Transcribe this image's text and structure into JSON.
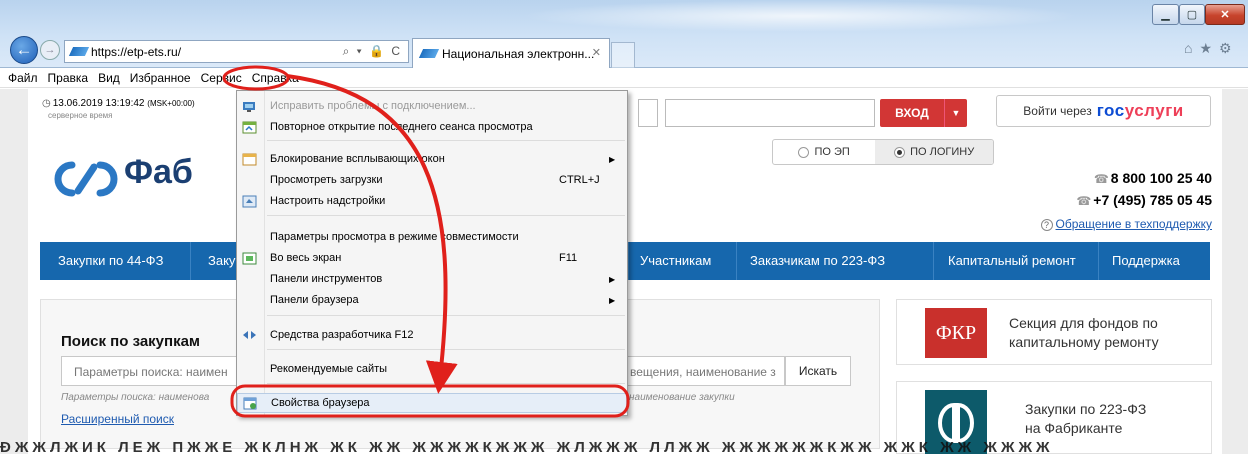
{
  "browser": {
    "url": "https://etp-ets.ru/",
    "tab_title": "Национальная электронн...",
    "tab_close": "✕",
    "min_glyph": "▁",
    "max_glyph": "▢",
    "close_glyph": "✕",
    "back_glyph": "←",
    "fwd_glyph": "→",
    "addr_tools": "⌕ ▾ 🔒 C",
    "right_icons": "⌂★⚙"
  },
  "menubar": [
    "Файл",
    "Правка",
    "Вид",
    "Избранное",
    "Сервис",
    "Справка"
  ],
  "page": {
    "server_time": "13.06.2019 13:19:42",
    "server_tz": "(MSK+00:00)",
    "server_sub": "серверное время",
    "login_btn": "ВХОД",
    "gos_prefix": "Войти через",
    "gos_a": "гос",
    "gos_b": "услуги",
    "seg_ep": "ПО ЭП",
    "seg_login": "ПО ЛОГИНУ",
    "logo_text": "Фаб",
    "phone1": "8 800 100 25 40",
    "phone2": "+7 (495) 785 05 45",
    "support": "Обращение в техподдержку",
    "nav": [
      "Закупки по 44-ФЗ",
      "Заку",
      "Участникам",
      "Заказчикам по 223-ФЗ",
      "Капитальный ремонт",
      "Поддержка"
    ],
    "search_title": "Поиск по закупкам",
    "search_left": "Параметры поиска: наимен",
    "search_right": "вещения, наименование з",
    "search_btn": "Искать",
    "hint_left": "Параметры поиска: наименова",
    "hint_right": "наименование закупки",
    "adv_link": "Расширенный поиск",
    "card1_icon": "ФКР",
    "card1_text": [
      "Секция для фондов по",
      "капитальному ремонту"
    ],
    "card2_text": [
      "Закупки по 223-ФЗ",
      "на Фабриканте"
    ],
    "garble": "ÐЖЖЛЖИК ЛЕЖ ПЖЖЕ ЖКЛНЖ ЖК ЖЖ ЖЖЖЖКЖЖЖ ЖЛЖЖЖ ЛЛЖЖ ЖЖЖЖЖЖКЖЖ ЖЖК ЖЖ ЖЖЖЖ"
  },
  "menu": {
    "items": [
      {
        "label": "Исправить проблемы с подключением...",
        "disabled": true,
        "icon": "network-icon"
      },
      {
        "label": "Повторное открытие последнего сеанса просмотра",
        "icon": "reopen-icon"
      },
      {
        "label": "Блокирование всплывающих окон",
        "submenu": true,
        "icon": "popup-icon"
      },
      {
        "label": "Просмотреть загрузки",
        "shortcut": "CTRL+J"
      },
      {
        "label": "Настроить надстройки",
        "icon": "addons-icon"
      },
      {
        "label": "Параметры просмотра в режиме совместимости"
      },
      {
        "label": "Во весь экран",
        "shortcut": "F11",
        "icon": "fullscreen-icon"
      },
      {
        "label": "Панели инструментов",
        "submenu": true
      },
      {
        "label": "Панели браузера",
        "submenu": true
      },
      {
        "label": "Средства разработчика F12",
        "icon": "devtools-icon"
      },
      {
        "label": "Рекомендуемые сайты"
      },
      {
        "label": "Свойства браузера",
        "icon": "properties-icon"
      }
    ],
    "submenu_arrow": "▶"
  },
  "annotations": {
    "highlight_color": "#e0201b"
  }
}
